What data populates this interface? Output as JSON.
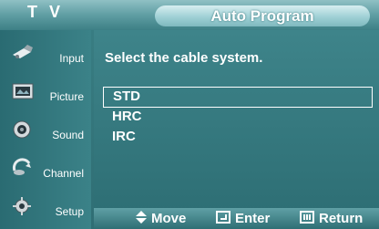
{
  "header": {
    "menu_title": "T V",
    "page_title": "Auto Program"
  },
  "sidebar": {
    "items": [
      {
        "label": "Input",
        "icon": "input-icon"
      },
      {
        "label": "Picture",
        "icon": "picture-icon"
      },
      {
        "label": "Sound",
        "icon": "sound-icon"
      },
      {
        "label": "Channel",
        "icon": "channel-icon"
      },
      {
        "label": "Setup",
        "icon": "setup-icon"
      }
    ]
  },
  "content": {
    "prompt": "Select the cable system.",
    "options": [
      "STD",
      "HRC",
      "IRC"
    ],
    "selected": "STD"
  },
  "footer": {
    "move": "Move",
    "enter": "Enter",
    "return": "Return"
  }
}
